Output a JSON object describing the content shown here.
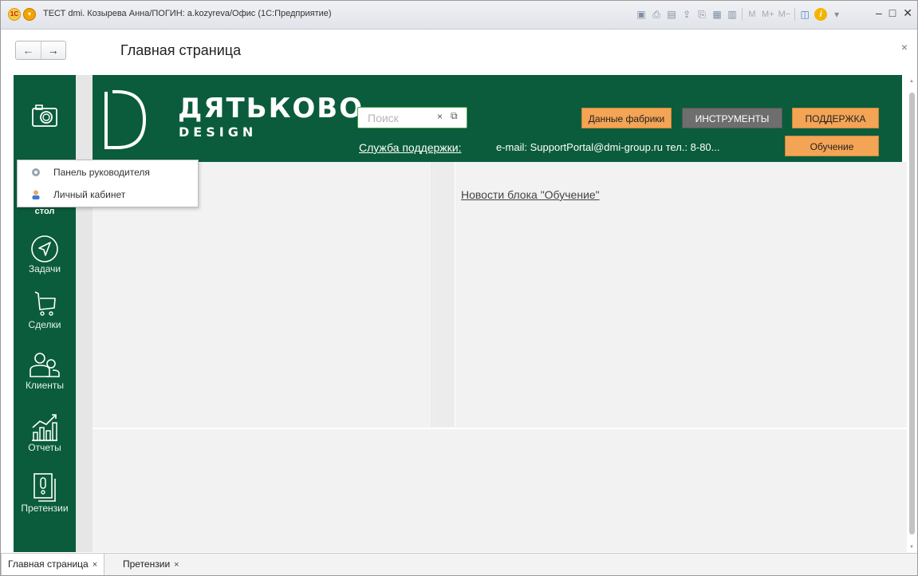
{
  "titlebar": {
    "title": "ТЕСТ dmi. Козырева Анна/ПОГИН: a.kozyreva/Офис  (1С:Предприятие)",
    "tool_mm": [
      "M",
      "M+",
      "M−"
    ]
  },
  "nav": {
    "back": "←",
    "forward": "→",
    "page_title": "Главная страница",
    "close": "×"
  },
  "sidebar": {
    "desk_label": "стол",
    "items": [
      {
        "label": "Задачи",
        "icon": "send-icon"
      },
      {
        "label": "Сделки",
        "icon": "cart-icon"
      },
      {
        "label": "Клиенты",
        "icon": "users-icon"
      },
      {
        "label": "Отчеты",
        "icon": "chart-icon"
      },
      {
        "label": "Претензии",
        "icon": "document-alert-icon"
      }
    ]
  },
  "dropdown": {
    "items": [
      {
        "label": "Панель руководителя",
        "icon": "gear-icon"
      },
      {
        "label": "Личный кабинет",
        "icon": "person-icon"
      }
    ]
  },
  "header": {
    "brand_name": "ДЯТЬКОВО",
    "brand_sub": "DESIGN",
    "search_placeholder": "Поиск",
    "search_clear": "×",
    "search_open": "⧉",
    "btn_factory": "Данные фабрики",
    "btn_tools": "ИНСТРУМЕНТЫ",
    "btn_support": "ПОДДЕРЖКА",
    "btn_training": "Обучение",
    "support_link": "Служба поддержки:",
    "contacts": "e-mail: SupportPortal@dmi-group.ru   тел.: 8-80..."
  },
  "content": {
    "news_link": "Новости блока \"Обучение\""
  },
  "tabs": [
    {
      "label": "Главная страница",
      "close": "×"
    },
    {
      "label": "Претензии",
      "close": "×"
    }
  ],
  "colors": {
    "brand_green": "#0a5c3c",
    "accent_orange": "#f3a455",
    "tools_gray": "#6e6e6e"
  }
}
